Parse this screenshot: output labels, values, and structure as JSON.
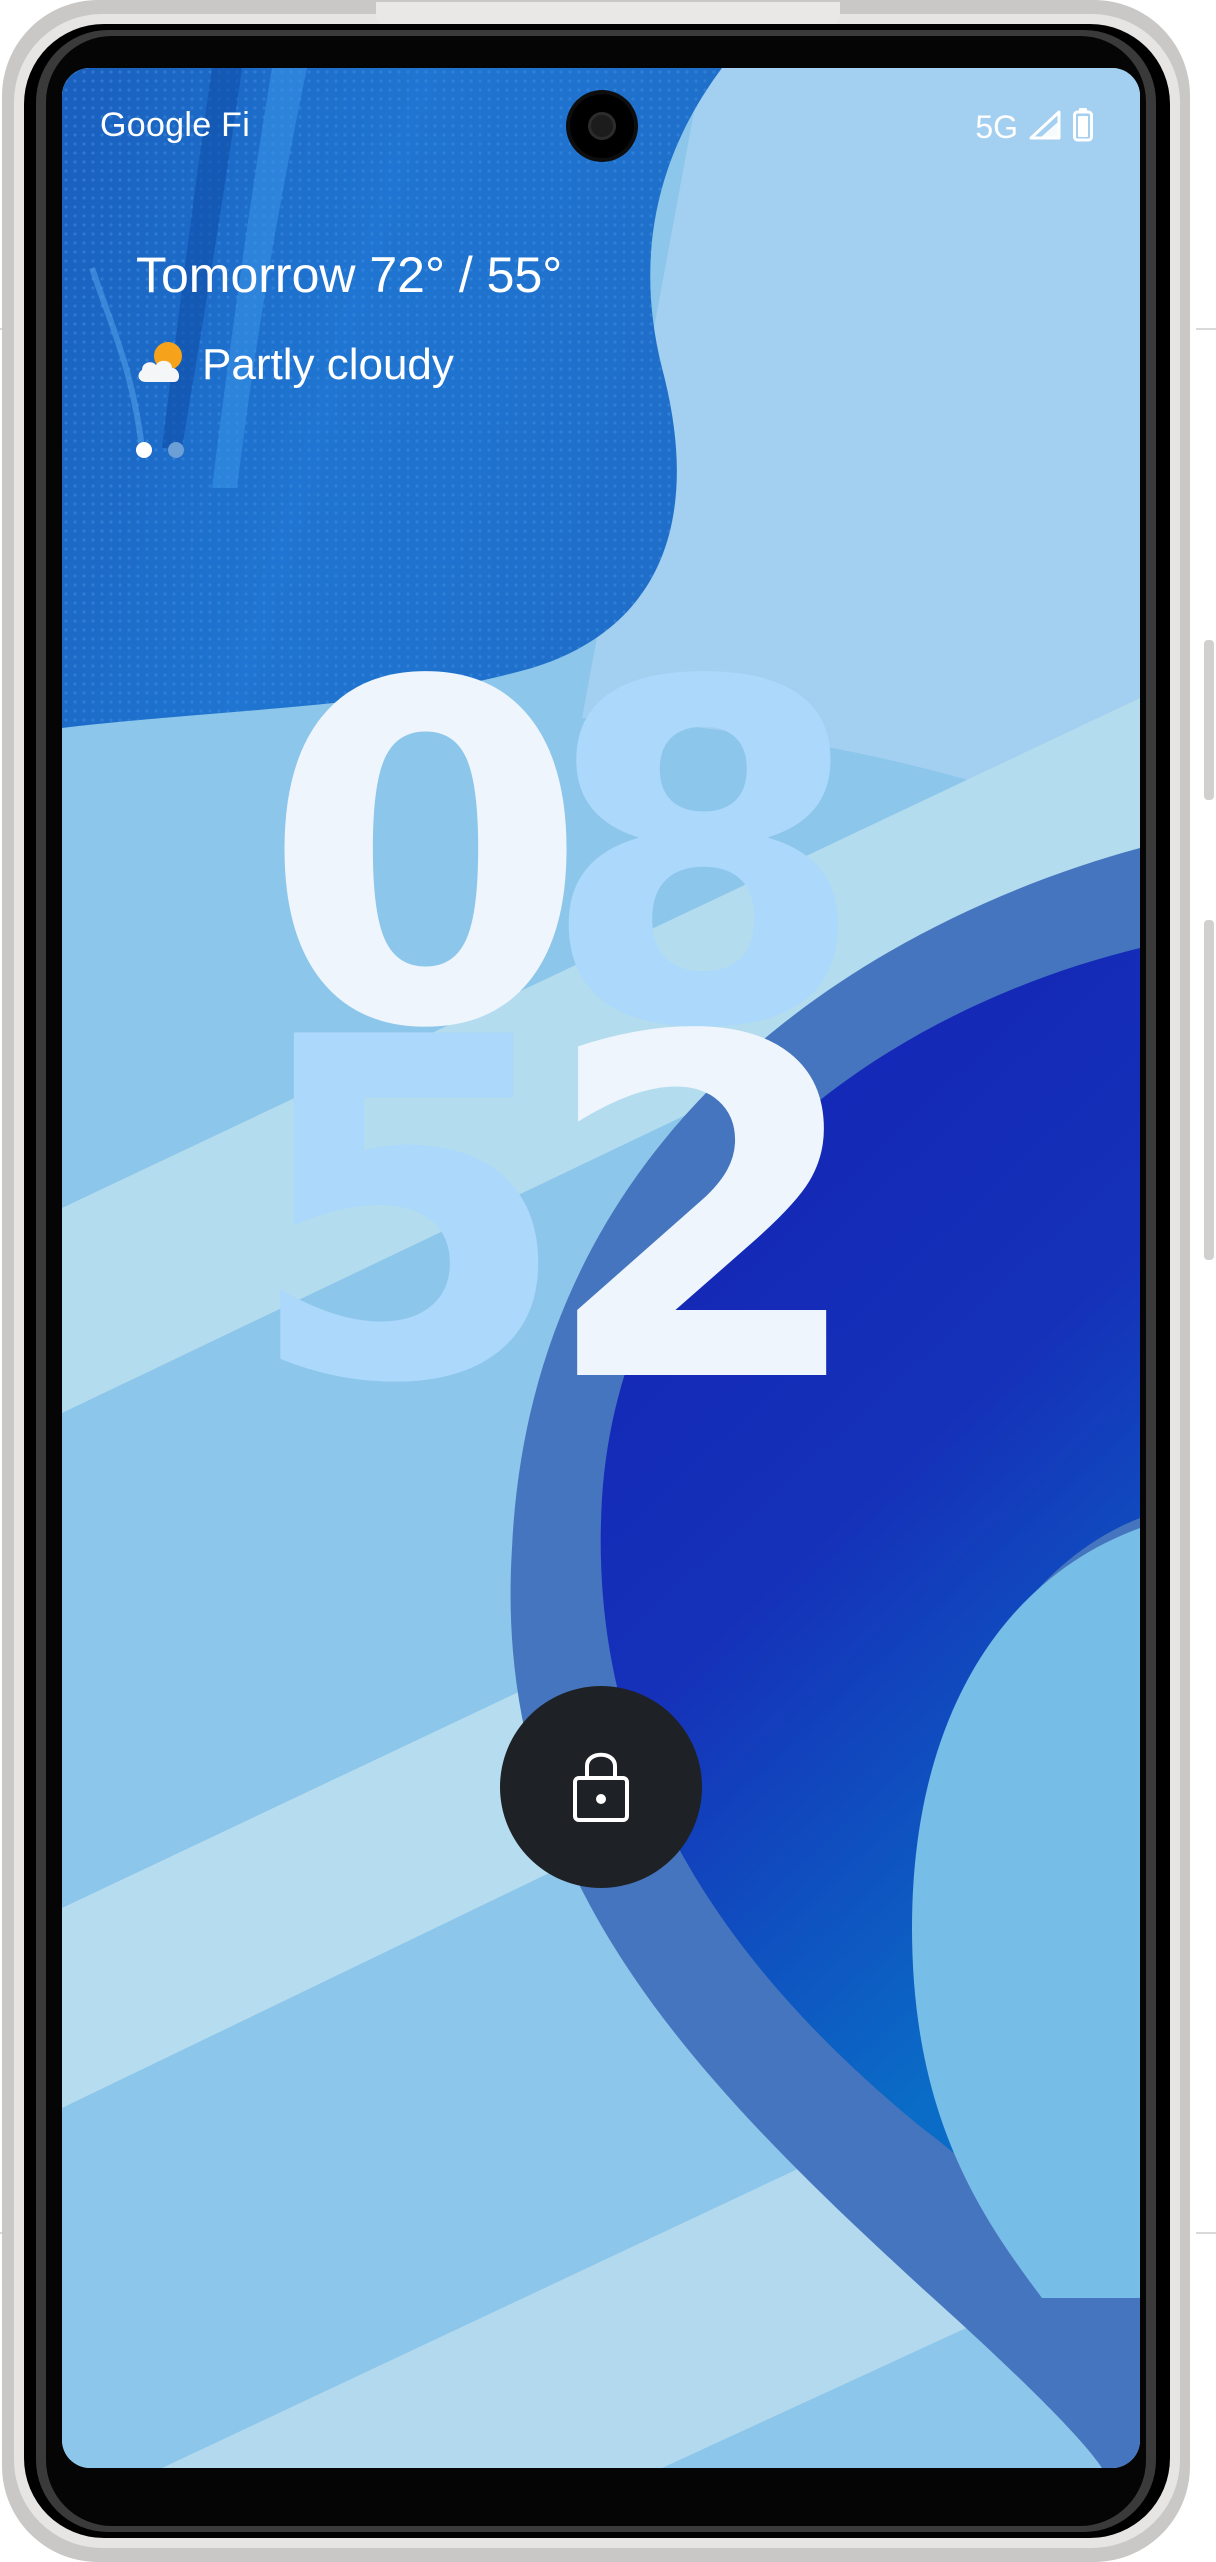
{
  "status_bar": {
    "carrier": "Google Fi",
    "network": "5G",
    "icons": [
      "camera-cutout-icon",
      "signal-icon",
      "battery-icon"
    ]
  },
  "weather": {
    "title": "Tomorrow 72° / 55°",
    "condition": "Partly cloudy",
    "icon": "partly-cloudy-icon",
    "pages": 2,
    "current_page": 1
  },
  "clock": {
    "hour": "08",
    "minute": "52",
    "digits": [
      "0",
      "8",
      "5",
      "2"
    ]
  },
  "lock": {
    "icon": "lock-icon"
  },
  "colors": {
    "primary_digit": "#eef5fc",
    "secondary_digit": "#abd8fb",
    "wallpaper_light": "#8fc8ea",
    "wallpaper_dark_blue": "#1322b5",
    "wallpaper_mid_blue": "#4574be",
    "lock_button": "#1e2226"
  }
}
